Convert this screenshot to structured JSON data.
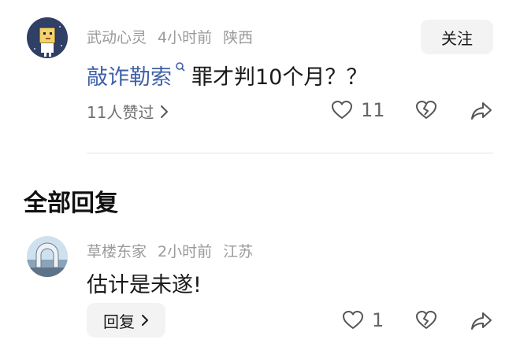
{
  "comment": {
    "username": "武动心灵",
    "time": "4小时前",
    "location": "陕西",
    "follow_label": "关注",
    "link_text": "敲诈勒索",
    "body_text": "罪才判10个月？？",
    "likers_text": "11人赞过",
    "like_count": "11"
  },
  "section": {
    "title": "全部回复"
  },
  "reply": {
    "username": "草楼东家",
    "time": "2小时前",
    "location": "江苏",
    "body_text": "估计是未遂!",
    "reply_label": "回复",
    "like_count": "1"
  },
  "colors": {
    "link": "#3d5fa8",
    "meta": "#9a9a9a",
    "button_bg": "#f3f3f3"
  },
  "icons": [
    "heart-icon",
    "broken-heart-icon",
    "share-icon",
    "chevron-right-icon",
    "search-icon"
  ]
}
